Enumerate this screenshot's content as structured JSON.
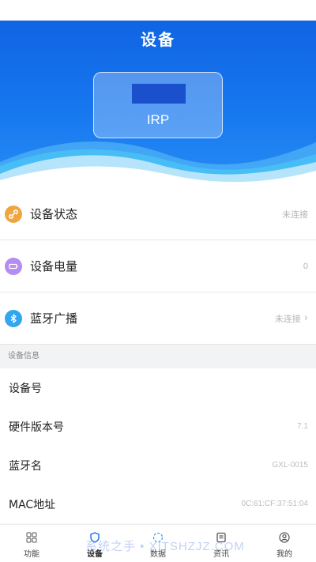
{
  "header": {
    "title": "设备"
  },
  "device": {
    "name": "IRP"
  },
  "status_rows": [
    {
      "label": "设备状态",
      "value": "未连接",
      "icon": "link-icon",
      "color": "#f0a640"
    },
    {
      "label": "设备电量",
      "value": "0",
      "icon": "battery-icon",
      "color": "#b58cf0"
    },
    {
      "label": "蓝牙广播",
      "value": "未连接",
      "icon": "bluetooth-icon",
      "color": "#33a6f0"
    }
  ],
  "device_info": {
    "section_title": "设备信息",
    "rows": [
      {
        "label": "设备号",
        "value": ""
      },
      {
        "label": "硬件版本号",
        "value": "7.1"
      },
      {
        "label": "蓝牙名",
        "value": "GXL-0015"
      },
      {
        "label": "MAC地址",
        "value": "0C:61:CF:37:51:04"
      }
    ]
  },
  "tabs": [
    {
      "label": "功能",
      "icon": "grid-icon"
    },
    {
      "label": "设备",
      "icon": "shield-icon"
    },
    {
      "label": "数据",
      "icon": "refresh-icon"
    },
    {
      "label": "资讯",
      "icon": "news-icon"
    },
    {
      "label": "我的",
      "icon": "user-icon"
    }
  ],
  "active_tab": "设备",
  "watermark": "系统之手 • XITSHZJZ.COM",
  "colors": {
    "primary": "#1677ef",
    "active_tab": "#1a6fe8"
  }
}
